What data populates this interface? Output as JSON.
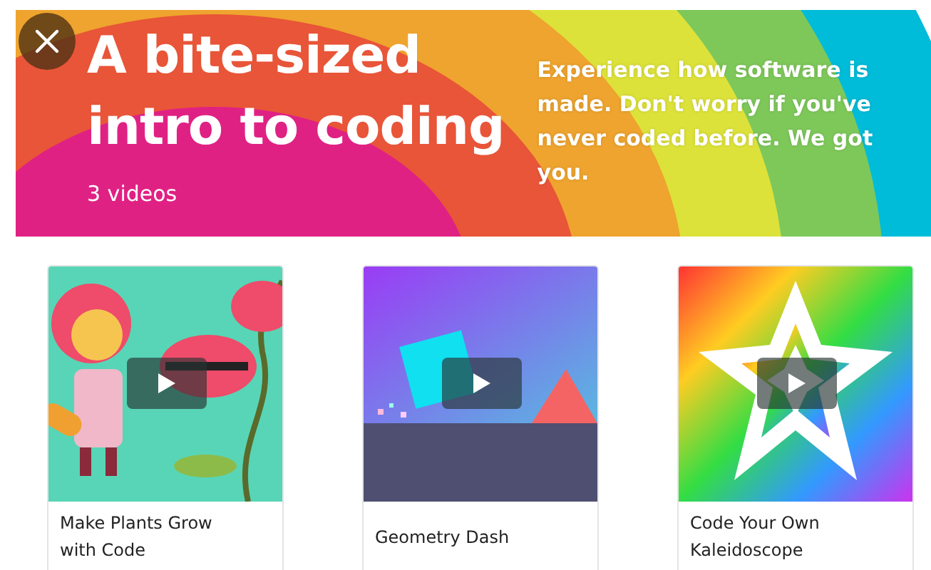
{
  "banner": {
    "title": "A bite-sized intro to coding",
    "count": "3 videos",
    "description": "Experience how software is made. Don't worry if you've never coded before. We got you."
  },
  "videos": [
    {
      "kind": "plants",
      "title": "Make Plants Grow with Code"
    },
    {
      "kind": "geometry",
      "title": "Geometry Dash"
    },
    {
      "kind": "kaleidoscope",
      "title": "Code Your Own Kaleidoscope"
    }
  ]
}
